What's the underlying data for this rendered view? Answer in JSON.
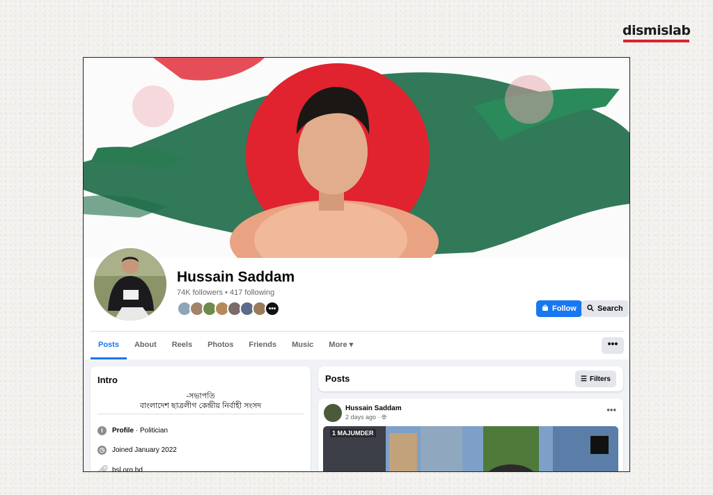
{
  "watermark": {
    "brand": "dismislab",
    "accent": "#d6262f"
  },
  "profile": {
    "name": "Hussain Saddam",
    "follows": "74K followers • 417 following",
    "friends_more": "•••"
  },
  "actions": {
    "follow": "Follow",
    "search": "Search"
  },
  "tabs": [
    {
      "label": "Posts",
      "active": true
    },
    {
      "label": "About"
    },
    {
      "label": "Reels"
    },
    {
      "label": "Photos"
    },
    {
      "label": "Friends"
    },
    {
      "label": "Music"
    },
    {
      "label": "More ▾"
    }
  ],
  "more_button": "•••",
  "intro": {
    "title": "Intro",
    "bio_line1": "-সভাপতি",
    "bio_line2": "বাংলাদেশ ছাত্রলীগ কেন্দ্রীয় নির্বাহী সংসদ",
    "profile_label": "Profile",
    "profile_value": " · Politician",
    "joined": "Joined January 2022",
    "website": "bsl.org.bd"
  },
  "posts": {
    "title": "Posts",
    "filters": "Filters",
    "post_author": "Hussain Saddam",
    "post_time": "2 days ago ·",
    "image_caption": "1 MAJUMDER"
  },
  "colors": {
    "primary": "#1877f2",
    "flag_green": "#1f6e4a",
    "flag_red": "#e0232f"
  }
}
